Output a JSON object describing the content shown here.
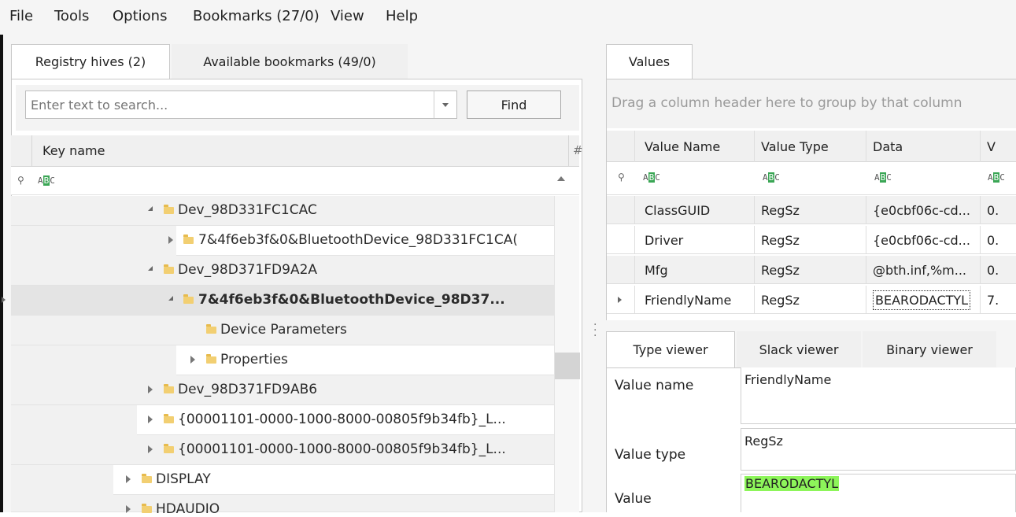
{
  "menu": {
    "items": [
      "File",
      "Tools",
      "Options",
      "Bookmarks (27/0)",
      "View",
      "Help"
    ]
  },
  "left_tabs": {
    "registry_hives": "Registry hives (2)",
    "available_bookmarks": "Available bookmarks (49/0)"
  },
  "search": {
    "placeholder": "Enter text to search...",
    "find_label": "Find"
  },
  "tree": {
    "header": {
      "key_name": "Key name",
      "extra": "#"
    },
    "filter_icon": "abc-filter-icon",
    "rows": [
      {
        "label": "Dev_98D331FC1CAC"
      },
      {
        "label": "7&4f6eb3f&0&BluetoothDevice_98D331FC1CA("
      },
      {
        "label": "Dev_98D371FD9A2A"
      },
      {
        "label": "7&4f6eb3f&0&BluetoothDevice_98D37..."
      },
      {
        "label": "Device Parameters"
      },
      {
        "label": "Properties"
      },
      {
        "label": "Dev_98D371FD9AB6"
      },
      {
        "label": "{00001101-0000-1000-8000-00805f9b34fb}_L..."
      },
      {
        "label": "{00001101-0000-1000-8000-00805f9b34fb}_L..."
      },
      {
        "label": "DISPLAY"
      },
      {
        "label": "HDAUDIO"
      }
    ]
  },
  "values_panel": {
    "tab": "Values",
    "group_hint": "Drag a column header here to group by that column",
    "columns": [
      "Value Name",
      "Value Type",
      "Data",
      "V"
    ],
    "rows": [
      {
        "name": "ClassGUID",
        "type": "RegSz",
        "data": "{e0cbf06c-cd...",
        "extra": "0."
      },
      {
        "name": "Driver",
        "type": "RegSz",
        "data": "{e0cbf06c-cd...",
        "extra": "0."
      },
      {
        "name": "Mfg",
        "type": "RegSz",
        "data": "@bth.inf,%m...",
        "extra": "0."
      },
      {
        "name": "FriendlyName",
        "type": "RegSz",
        "data": "BEARODACTYL",
        "extra": "7."
      }
    ]
  },
  "viewer": {
    "tabs": [
      "Type viewer",
      "Slack viewer",
      "Binary viewer"
    ],
    "fields": [
      {
        "label": "Value name",
        "value": "FriendlyName"
      },
      {
        "label": "Value type",
        "value": "RegSz"
      },
      {
        "label": "Value",
        "value": "BEARODACTYL"
      }
    ],
    "highlight_color": "#8df55a"
  }
}
